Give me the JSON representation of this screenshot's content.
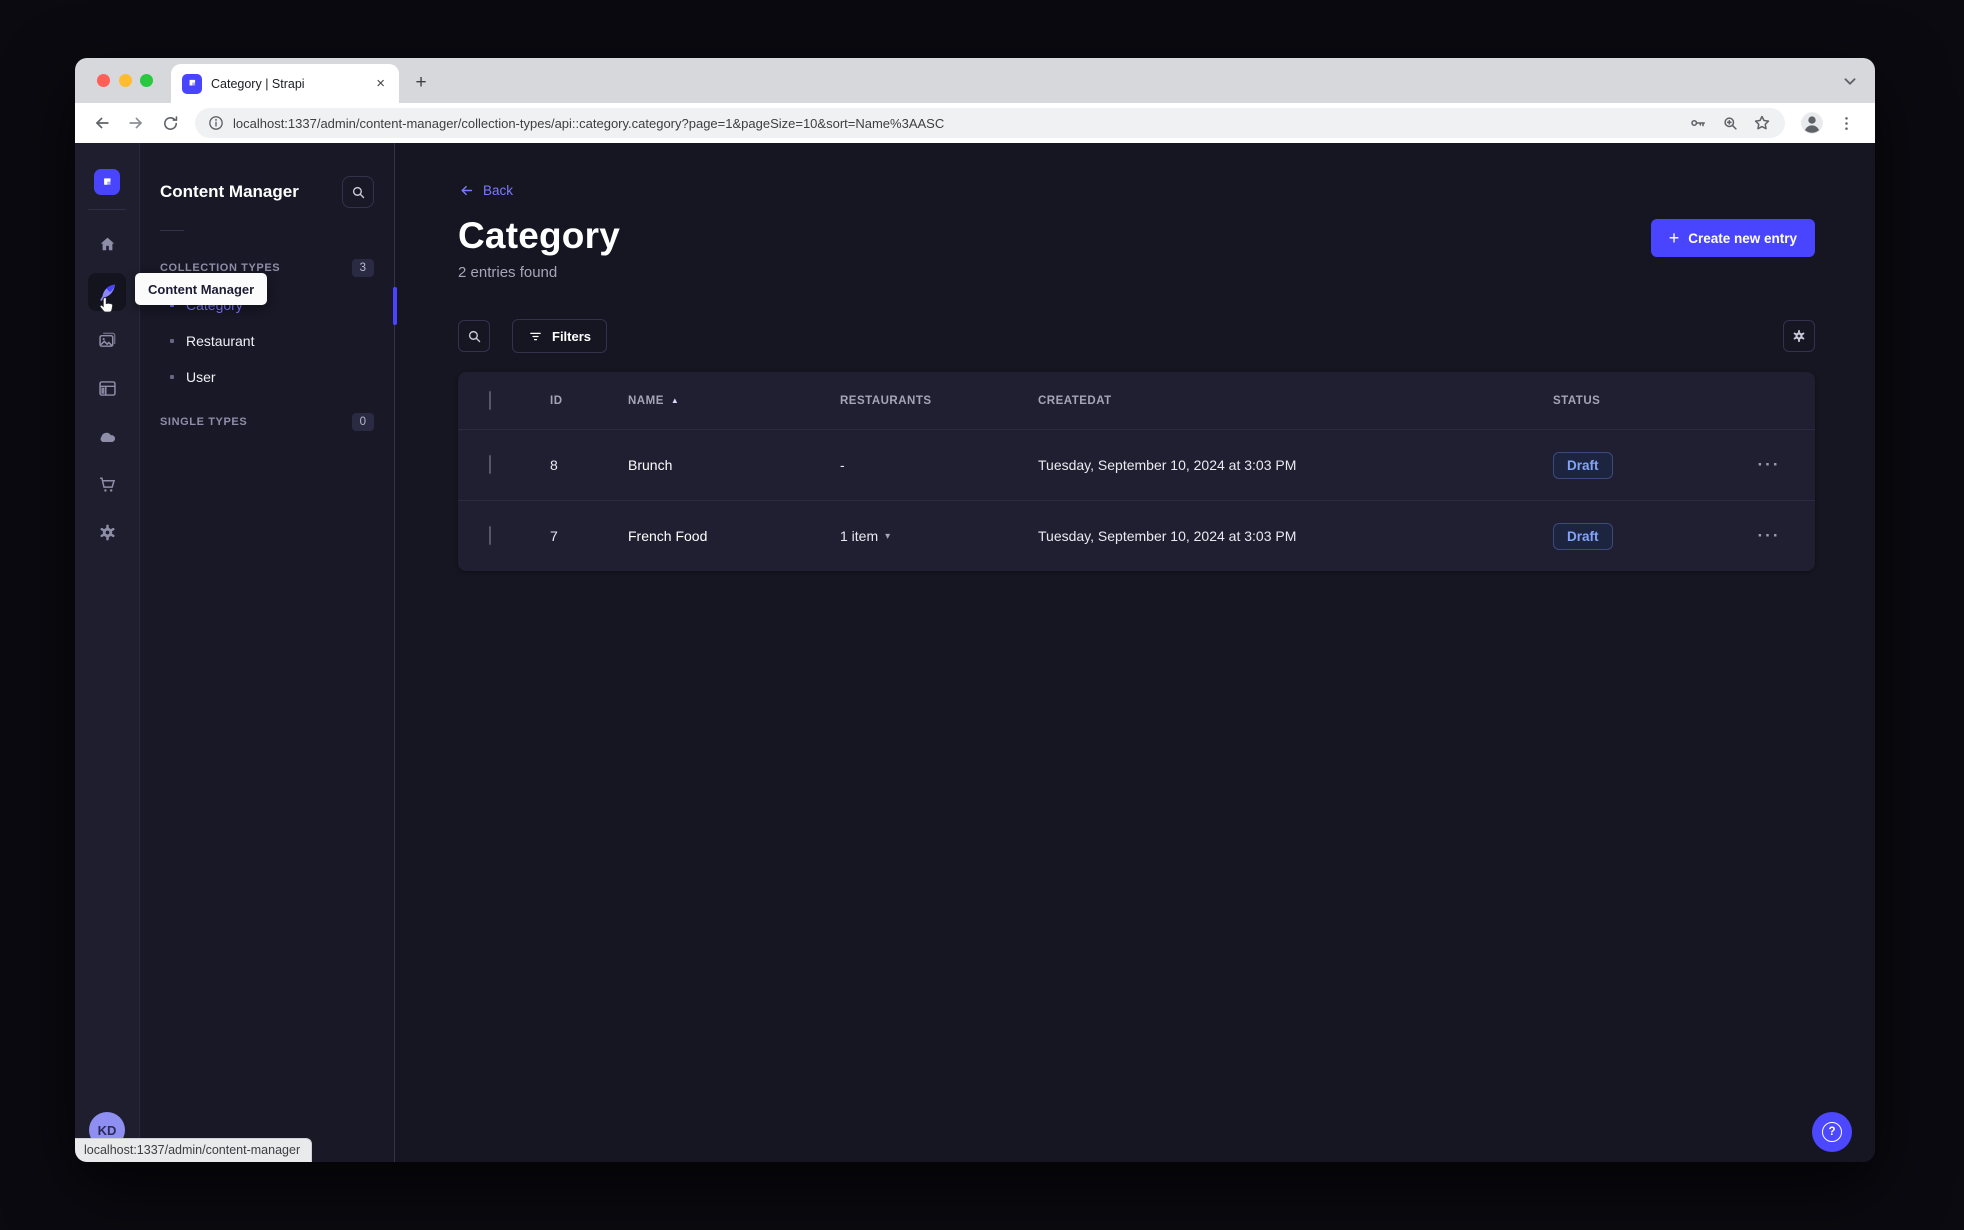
{
  "browser": {
    "tab_title": "Category | Strapi",
    "url": "localhost:1337/admin/content-manager/collection-types/api::category.category?page=1&pageSize=10&sort=Name%3AASC",
    "status_bar": "localhost:1337/admin/content-manager"
  },
  "icons": {
    "close_tab": "×",
    "new_tab": "+",
    "plus": "+",
    "sort_asc": "▲",
    "caret_down": "▾",
    "row_actions": "···",
    "question": "?"
  },
  "colors": {
    "accent": "#4945ff",
    "link": "#7b79ff",
    "draft_text": "#83a5f7",
    "traffic_red": "#ff5f57",
    "traffic_yellow": "#febc2e",
    "traffic_green": "#28c840"
  },
  "sidebar": {
    "tooltip": "Content Manager",
    "avatar_initials": "KD"
  },
  "panel": {
    "title": "Content Manager",
    "collection_types": {
      "label": "COLLECTION TYPES",
      "count": "3",
      "items": [
        {
          "label": "Category"
        },
        {
          "label": "Restaurant"
        },
        {
          "label": "User"
        }
      ]
    },
    "single_types": {
      "label": "SINGLE TYPES",
      "count": "0"
    }
  },
  "main": {
    "back_label": "Back",
    "title": "Category",
    "subtitle": "2 entries found",
    "create_button": "Create new entry",
    "filters_button": "Filters",
    "table": {
      "headers": {
        "id": "ID",
        "name": "NAME",
        "restaurants": "RESTAURANTS",
        "createdat": "CREATEDAT",
        "status": "STATUS"
      },
      "rows": [
        {
          "id": "8",
          "name": "Brunch",
          "restaurants": "-",
          "created": "Tuesday, September 10, 2024 at 3:03 PM",
          "status": "Draft"
        },
        {
          "id": "7",
          "name": "French Food",
          "restaurants": "1 item",
          "created": "Tuesday, September 10, 2024 at 3:03 PM",
          "status": "Draft"
        }
      ]
    }
  }
}
